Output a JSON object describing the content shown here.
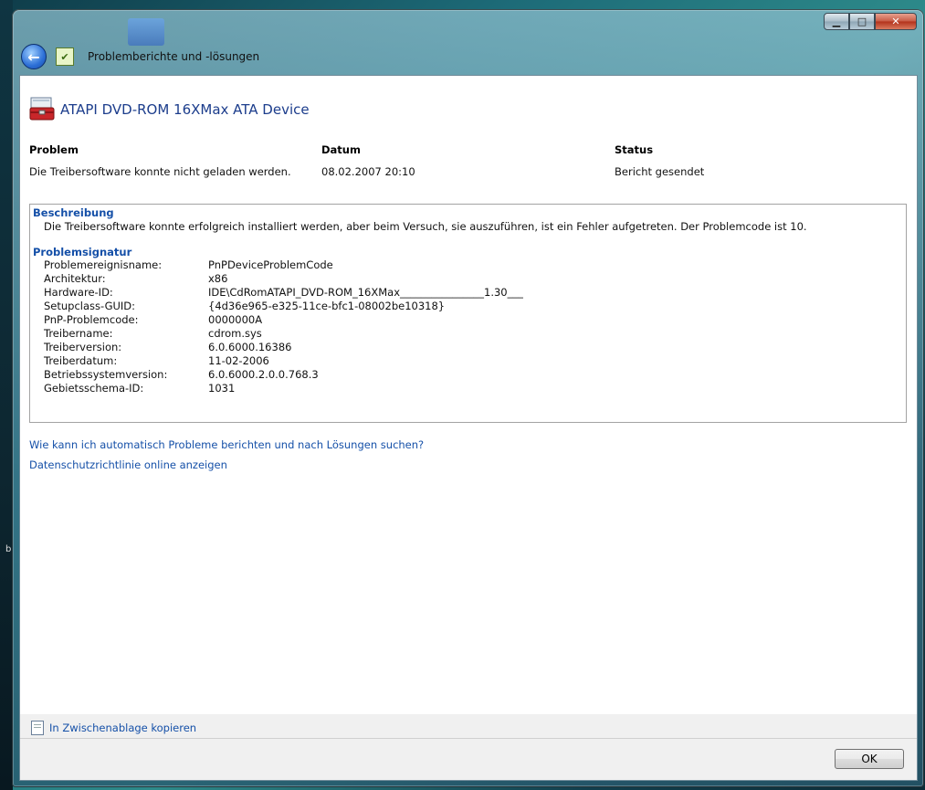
{
  "desktop": {
    "fragment": "b"
  },
  "window": {
    "breadcrumb": "Problemberichte und -lösungen",
    "controls": {
      "minimize": "▁",
      "maximize": "□",
      "close": "✕"
    }
  },
  "header": {
    "title": "ATAPI DVD-ROM 16XMax ATA Device"
  },
  "summary": {
    "problem_label": "Problem",
    "problem_value": "Die Treibersoftware konnte nicht geladen werden.",
    "date_label": "Datum",
    "date_value": "08.02.2007 20:10",
    "status_label": "Status",
    "status_value": "Bericht gesendet"
  },
  "details": {
    "description_title": "Beschreibung",
    "description_text": "Die Treibersoftware konnte erfolgreich installiert werden, aber beim Versuch, sie auszuführen, ist ein Fehler aufgetreten. Der Problemcode ist 10.",
    "signature_title": "Problemsignatur",
    "signature": [
      {
        "key": "Problemereignisname:",
        "value": "PnPDeviceProblemCode"
      },
      {
        "key": "Architektur:",
        "value": "x86"
      },
      {
        "key": "Hardware-ID:",
        "value": "IDE\\CdRomATAPI_DVD-ROM_16XMax________________1.30___"
      },
      {
        "key": "Setupclass-GUID:",
        "value": "{4d36e965-e325-11ce-bfc1-08002be10318}"
      },
      {
        "key": "PnP-Problemcode:",
        "value": "0000000A"
      },
      {
        "key": "Treibername:",
        "value": "cdrom.sys"
      },
      {
        "key": "Treiberversion:",
        "value": "6.0.6000.16386"
      },
      {
        "key": "Treiberdatum:",
        "value": "11-02-2006"
      },
      {
        "key": "Betriebssystemversion:",
        "value": "6.0.6000.2.0.0.768.3"
      },
      {
        "key": "Gebietsschema-ID:",
        "value": "1031"
      }
    ]
  },
  "links": {
    "auto_report": "Wie kann ich automatisch Probleme berichten und nach Lösungen suchen?",
    "privacy": "Datenschutzrichtlinie online anzeigen"
  },
  "footer": {
    "copy_label": "In Zwischenablage kopieren",
    "ok_label": "OK"
  }
}
